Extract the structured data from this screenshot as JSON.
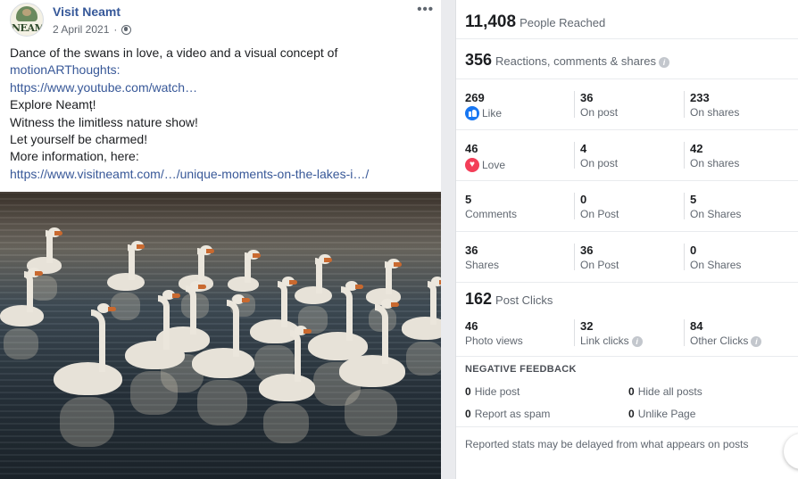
{
  "post": {
    "page_name": "Visit Neamt",
    "date": "2 April 2021",
    "avatar_text": "NEAMT",
    "lines": [
      {
        "text": "Dance of the swans in love, a video and a visual concept of",
        "link": false
      },
      {
        "text": "motionARThoughts:",
        "link": true
      },
      {
        "text": "https://www.youtube.com/watch…",
        "link": true
      },
      {
        "text": "Explore Neamț!",
        "link": false
      },
      {
        "text": "Witness the limitless nature show!",
        "link": false
      },
      {
        "text": "Let yourself be charmed!",
        "link": false
      },
      {
        "text": "More information, here:",
        "link": false
      },
      {
        "text": "https://www.visitneamt.com/…/unique-moments-on-the-lakes-i…/",
        "link": true
      }
    ],
    "image_description_icon": "photo-of-swans"
  },
  "stats": {
    "reached_value": "11,408",
    "reached_label": "People Reached",
    "engagement_value": "356",
    "engagement_label": "Reactions, comments & shares",
    "rows": [
      {
        "c1_value": "269",
        "c1_label": "Like",
        "c1_icon": "like",
        "c2_value": "36",
        "c2_label": "On post",
        "c3_value": "233",
        "c3_label": "On shares"
      },
      {
        "c1_value": "46",
        "c1_label": "Love",
        "c1_icon": "love",
        "c2_value": "4",
        "c2_label": "On post",
        "c3_value": "42",
        "c3_label": "On shares"
      },
      {
        "c1_value": "5",
        "c1_label": "Comments",
        "c1_icon": "",
        "c2_value": "0",
        "c2_label": "On Post",
        "c3_value": "5",
        "c3_label": "On Shares"
      },
      {
        "c1_value": "36",
        "c1_label": "Shares",
        "c1_icon": "",
        "c2_value": "36",
        "c2_label": "On Post",
        "c3_value": "0",
        "c3_label": "On Shares"
      }
    ],
    "clicks_value": "162",
    "clicks_label": "Post Clicks",
    "clicks_row": {
      "c1_value": "46",
      "c1_label": "Photo views",
      "c2_value": "32",
      "c2_label": "Link clicks",
      "c3_value": "84",
      "c3_label": "Other Clicks"
    },
    "negative": {
      "title": "NEGATIVE FEEDBACK",
      "hide_post_value": "0",
      "hide_post_label": "Hide post",
      "hide_all_value": "0",
      "hide_all_label": "Hide all posts",
      "spam_value": "0",
      "spam_label": "Report as spam",
      "unlike_value": "0",
      "unlike_label": "Unlike Page"
    },
    "footnote": "Reported stats may be delayed from what appears on posts"
  },
  "colors": {
    "link": "#385898",
    "like": "#1877f2",
    "love": "#f33e58"
  }
}
